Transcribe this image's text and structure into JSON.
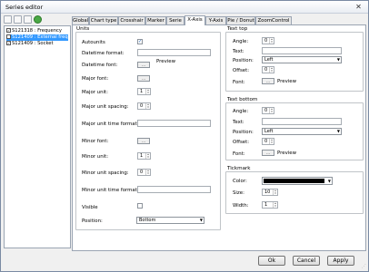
{
  "window": {
    "title": "Series editor",
    "close_glyph": "✕"
  },
  "series_list": [
    {
      "label": "S121318 : Frequency",
      "checked": true,
      "selected": false
    },
    {
      "label": "S121409 : External freq",
      "checked": true,
      "selected": true
    },
    {
      "label": "S121409 : Socket",
      "checked": true,
      "selected": false
    }
  ],
  "tabs": [
    "Global",
    "Chart type",
    "Crosshair",
    "Marker",
    "Serie",
    "X-Axis",
    "Y-Axis",
    "Pie / Donut",
    "ZoomControl"
  ],
  "active_tab": "X-Axis",
  "units": {
    "title": "Units",
    "autounits_label": "Autounits",
    "autounits_checked": true,
    "datetime_format_label": "Datetime format:",
    "datetime_font_label": "Datetime font:",
    "preview_label": "Preview",
    "major_font_label": "Major font:",
    "major_unit_label": "Major unit:",
    "major_unit_value": "1",
    "major_unit_spacing_label": "Major unit spacing:",
    "major_unit_spacing_value": "0",
    "major_unit_time_format_label": "Major unit time format:",
    "minor_font_label": "Minor font:",
    "minor_unit_label": "Minor unit:",
    "minor_unit_value": "1",
    "minor_unit_spacing_label": "Minor unit spacing:",
    "minor_unit_spacing_value": "0",
    "minor_unit_time_format_label": "Minor unit time format:",
    "visible_label": "Visible",
    "position_label": "Position:",
    "position_value": "Bottom",
    "browse_label": "..."
  },
  "text_top": {
    "title": "Text top",
    "angle_label": "Angle:",
    "angle_value": "0",
    "text_label": "Text:",
    "position_label": "Position:",
    "position_value": "Left",
    "offset_label": "Offset:",
    "offset_value": "0",
    "font_label": "Font:",
    "preview_label": "Preview"
  },
  "text_bottom": {
    "title": "Text bottom",
    "angle_label": "Angle:",
    "angle_value": "0",
    "text_label": "Text:",
    "position_label": "Position:",
    "position_value": "Left",
    "offset_label": "Offset:",
    "offset_value": "0",
    "font_label": "Font:",
    "preview_label": "Preview"
  },
  "tickmark": {
    "title": "Tickmark",
    "color_label": "Color:",
    "color_value": "#000000",
    "size_label": "Size:",
    "size_value": "10",
    "width_label": "Width:",
    "width_value": "1"
  },
  "footer": {
    "ok": "Ok",
    "cancel": "Cancel",
    "apply": "Apply"
  }
}
